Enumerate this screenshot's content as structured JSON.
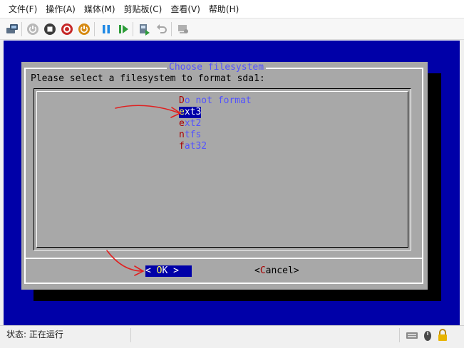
{
  "menubar": {
    "items": [
      {
        "label": "文件(F)"
      },
      {
        "label": "操作(A)"
      },
      {
        "label": "媒体(M)"
      },
      {
        "label": "剪贴板(C)"
      },
      {
        "label": "查看(V)"
      },
      {
        "label": "帮助(H)"
      }
    ]
  },
  "toolbar": {
    "icons": [
      "ctrl-alt-del-icon",
      "start-icon",
      "turn-off-icon",
      "shut-down-icon",
      "power-icon",
      "pause-icon",
      "resume-icon",
      "checkpoint-icon",
      "revert-icon",
      "enhanced-session-icon"
    ]
  },
  "dialog": {
    "title": "Choose filesystem",
    "prompt": "Please select a filesystem to format sda1:",
    "options": [
      {
        "hotkey": "D",
        "rest": "o not format",
        "selected": false
      },
      {
        "hotkey": "e",
        "rest": "xt3",
        "selected": true
      },
      {
        "hotkey": "e",
        "rest": "xt2",
        "selected": false
      },
      {
        "hotkey": "n",
        "rest": "tfs",
        "selected": false
      },
      {
        "hotkey": "f",
        "rest": "at32",
        "selected": false
      }
    ],
    "ok_button": {
      "left": "< ",
      "hotkey": "O",
      "rest": "K >"
    },
    "cancel_button": {
      "left": "<",
      "hotkey": "C",
      "rest": "ancel>"
    }
  },
  "statusbar": {
    "status_text": "状态: 正在运行"
  },
  "colors": {
    "vm_background": "#0000a8",
    "dialog_background": "#a8a8a8",
    "title_blue": "#5353ff",
    "hotkey_red": "#a80000",
    "hotkey_yellow": "#ffff54",
    "annotation_red": "#e02020"
  }
}
